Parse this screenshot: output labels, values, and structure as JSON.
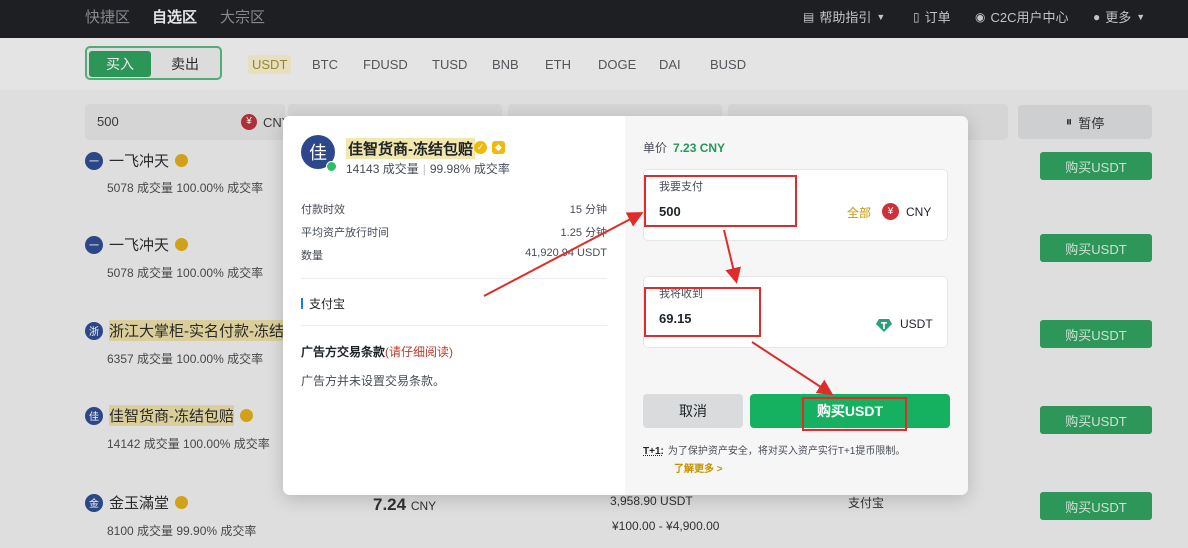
{
  "topnav": {
    "tabs": [
      "快捷区",
      "自选区",
      "大宗区"
    ],
    "active_tab": "自选区",
    "right": {
      "help": "帮助指引",
      "orders": "订单",
      "c2c": "C2C用户中心",
      "more": "更多"
    }
  },
  "filter": {
    "buy_label": "买入",
    "sell_label": "卖出",
    "coins": [
      "USDT",
      "BTC",
      "FDUSD",
      "TUSD",
      "BNB",
      "ETH",
      "DOGE",
      "DAI",
      "BUSD"
    ],
    "active_coin": "USDT",
    "amount_value": "500",
    "amount_currency": "CNY",
    "pause_label": "暂停"
  },
  "background_list": {
    "buy_button_label": "购买USDT",
    "rows": [
      {
        "name": "一飞冲天",
        "stats": "5078 成交量    100.00% 成交率"
      },
      {
        "name": "一飞冲天",
        "stats": "5078 成交量    100.00% 成交率"
      },
      {
        "name": "浙江大掌柜-实名付款-冻结包",
        "stats": "6357 成交量    100.00% 成交率"
      },
      {
        "name": "佳智货商-冻结包赔",
        "stats": "14142 成交量    100.00% 成交率"
      },
      {
        "name": "金玉滿堂",
        "stats": "8100 成交量    99.90% 成交率"
      }
    ],
    "bottom_price": "7.24",
    "bottom_price_unit": "CNY",
    "bottom_qty": "3,958.90 USDT",
    "bottom_limit": "¥100.00 - ¥4,900.00",
    "bottom_payment": "支付宝"
  },
  "modal": {
    "merchant": {
      "avatar_char": "佳",
      "name": "佳智货商-冻结包赔",
      "trades": "14143 成交量",
      "rate": "99.98% 成交率"
    },
    "details": [
      {
        "key": "付款时效",
        "value": "15 分钟"
      },
      {
        "key": "平均资产放行时间",
        "value": "1.25 分钟"
      },
      {
        "key": "数量",
        "value": "41,920.94 USDT"
      }
    ],
    "payment_method": "支付宝",
    "terms_title": "广告方交易条款",
    "terms_link": "(请仔细阅读)",
    "terms_body": "广告方并未设置交易条款。",
    "price_label": "单价",
    "price_value": "7.23 CNY",
    "pay": {
      "label": "我要支付",
      "value": "500",
      "all_label": "全部",
      "currency": "CNY"
    },
    "receive": {
      "label": "我将收到",
      "value": "69.15",
      "currency": "USDT"
    },
    "cancel_label": "取消",
    "confirm_label": "购买USDT",
    "t1_tag": "T+1:",
    "t1_text": "为了保护资产安全，将对买入资产实行T+1提币限制。",
    "learn_more": "了解更多 >"
  },
  "colors": {
    "green": "#16b160",
    "gold": "#f0b90b",
    "annotation_red": "#e02b2b"
  }
}
